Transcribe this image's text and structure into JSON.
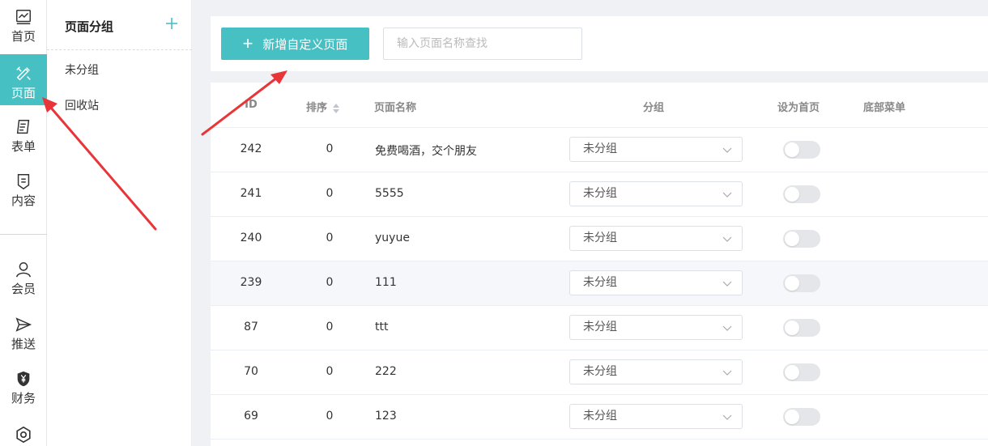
{
  "nav": {
    "items": [
      {
        "label": "首页",
        "icon": "chart-icon"
      },
      {
        "label": "页面",
        "icon": "design-tools-icon"
      },
      {
        "label": "表单",
        "icon": "form-icon"
      },
      {
        "label": "内容",
        "icon": "content-icon"
      },
      {
        "label": "会员",
        "icon": "user-icon"
      },
      {
        "label": "推送",
        "icon": "send-icon"
      },
      {
        "label": "财务",
        "icon": "yuan-shield-icon"
      }
    ],
    "active": "页面"
  },
  "groups": {
    "title": "页面分组",
    "items": [
      "未分组",
      "回收站"
    ]
  },
  "toolbar": {
    "add_label": "新增自定义页面",
    "search_placeholder": "输入页面名称查找"
  },
  "table": {
    "headers": {
      "id": "ID",
      "sort": "排序",
      "name": "页面名称",
      "group": "分组",
      "set_home": "设为首页",
      "bottom_menu": "底部菜单"
    },
    "rows": [
      {
        "id": "242",
        "sort": "0",
        "name": "免费喝酒，交个朋友",
        "group": "未分组",
        "home": false
      },
      {
        "id": "241",
        "sort": "0",
        "name": "5555",
        "group": "未分组",
        "home": false
      },
      {
        "id": "240",
        "sort": "0",
        "name": "yuyue",
        "group": "未分组",
        "home": false
      },
      {
        "id": "239",
        "sort": "0",
        "name": "111",
        "group": "未分组",
        "home": false
      },
      {
        "id": "87",
        "sort": "0",
        "name": "ttt",
        "group": "未分组",
        "home": false
      },
      {
        "id": "70",
        "sort": "0",
        "name": "222",
        "group": "未分组",
        "home": false
      },
      {
        "id": "69",
        "sort": "0",
        "name": "123",
        "group": "未分组",
        "home": false
      }
    ]
  },
  "colors": {
    "accent": "#47c0c4",
    "annotation": "#e8353a"
  }
}
